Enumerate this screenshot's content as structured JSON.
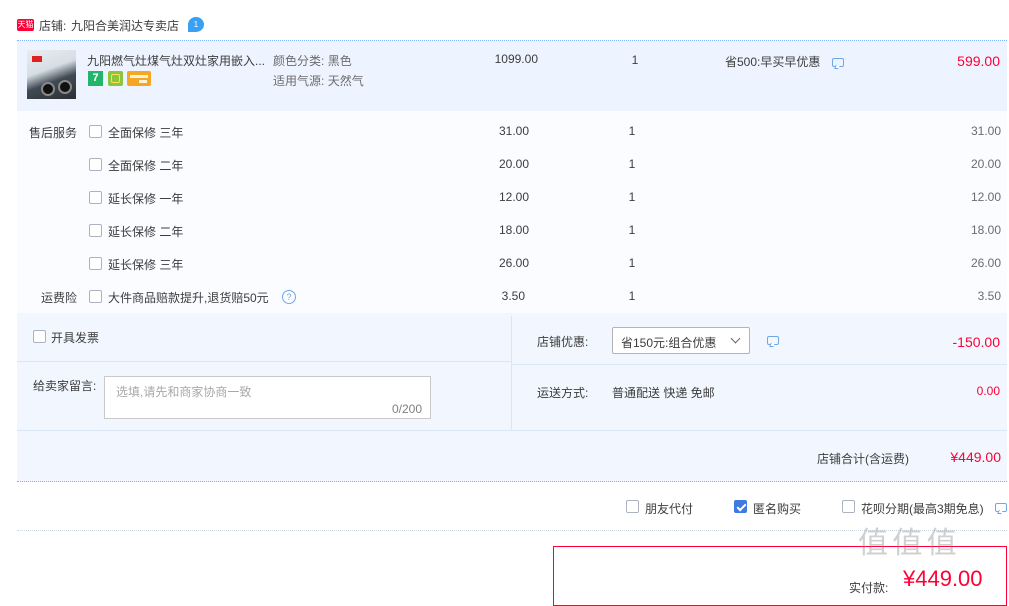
{
  "shop": {
    "badge": "天猫",
    "label": "店铺:",
    "name": "九阳合美润达专卖店",
    "wangwang_badge": "1"
  },
  "product": {
    "title": "九阳燃气灶煤气灶双灶家用嵌入...",
    "attr1_label": "颜色分类:",
    "attr1_value": "黑色",
    "attr2_label": "适用气源:",
    "attr2_value": "天然气",
    "price": "1099.00",
    "qty": "1",
    "promo": "省500:早买早优惠",
    "subtotal": "599.00",
    "badge7": "7"
  },
  "services": {
    "section_label": "售后服务",
    "items": [
      {
        "name": "全面保修 三年",
        "price": "31.00",
        "qty": "1",
        "subtotal": "31.00"
      },
      {
        "name": "全面保修 二年",
        "price": "20.00",
        "qty": "1",
        "subtotal": "20.00"
      },
      {
        "name": "延长保修 一年",
        "price": "12.00",
        "qty": "1",
        "subtotal": "12.00"
      },
      {
        "name": "延长保修 二年",
        "price": "18.00",
        "qty": "1",
        "subtotal": "18.00"
      },
      {
        "name": "延长保修 三年",
        "price": "26.00",
        "qty": "1",
        "subtotal": "26.00"
      }
    ]
  },
  "insurance": {
    "section_label": "运费险",
    "name": "大件商品赔款提升,退货赔50元",
    "help": "?",
    "price": "3.50",
    "qty": "1",
    "subtotal": "3.50"
  },
  "invoice": {
    "label": "开具发票"
  },
  "message": {
    "label": "给卖家留言:",
    "placeholder": "选填,请先和商家协商一致",
    "counter": "0/200"
  },
  "discount": {
    "label": "店铺优惠:",
    "selected": "省150元:组合优惠",
    "amount": "-150.00"
  },
  "shipping": {
    "label": "运送方式:",
    "value": "普通配送 快递 免邮",
    "amount": "0.00"
  },
  "shop_total": {
    "label": "店铺合计(含运费)",
    "amount": "¥449.00"
  },
  "options": {
    "friend_pay": "朋友代付",
    "anonymous": "匿名购买",
    "huabei": "花呗分期(最高3期免息)"
  },
  "final": {
    "label": "实付款:",
    "amount": "¥449.00",
    "watermark": "值 值 值"
  }
}
